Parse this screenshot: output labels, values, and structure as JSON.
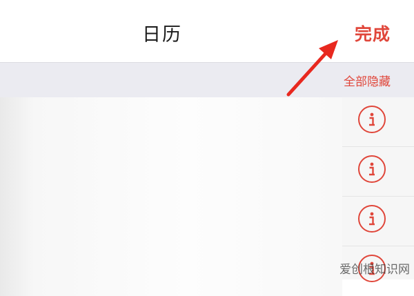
{
  "header": {
    "title": "日历",
    "done_label": "完成"
  },
  "section": {
    "hide_all_label": "全部隐藏"
  },
  "calendars": [
    {
      "info_icon": "info-icon"
    },
    {
      "info_icon": "info-icon"
    },
    {
      "info_icon": "info-icon"
    },
    {
      "info_icon": "info-icon"
    }
  ],
  "watermark": "爱创根知识网",
  "colors": {
    "accent": "#e0463a",
    "section_bg": "#ebebf1"
  }
}
